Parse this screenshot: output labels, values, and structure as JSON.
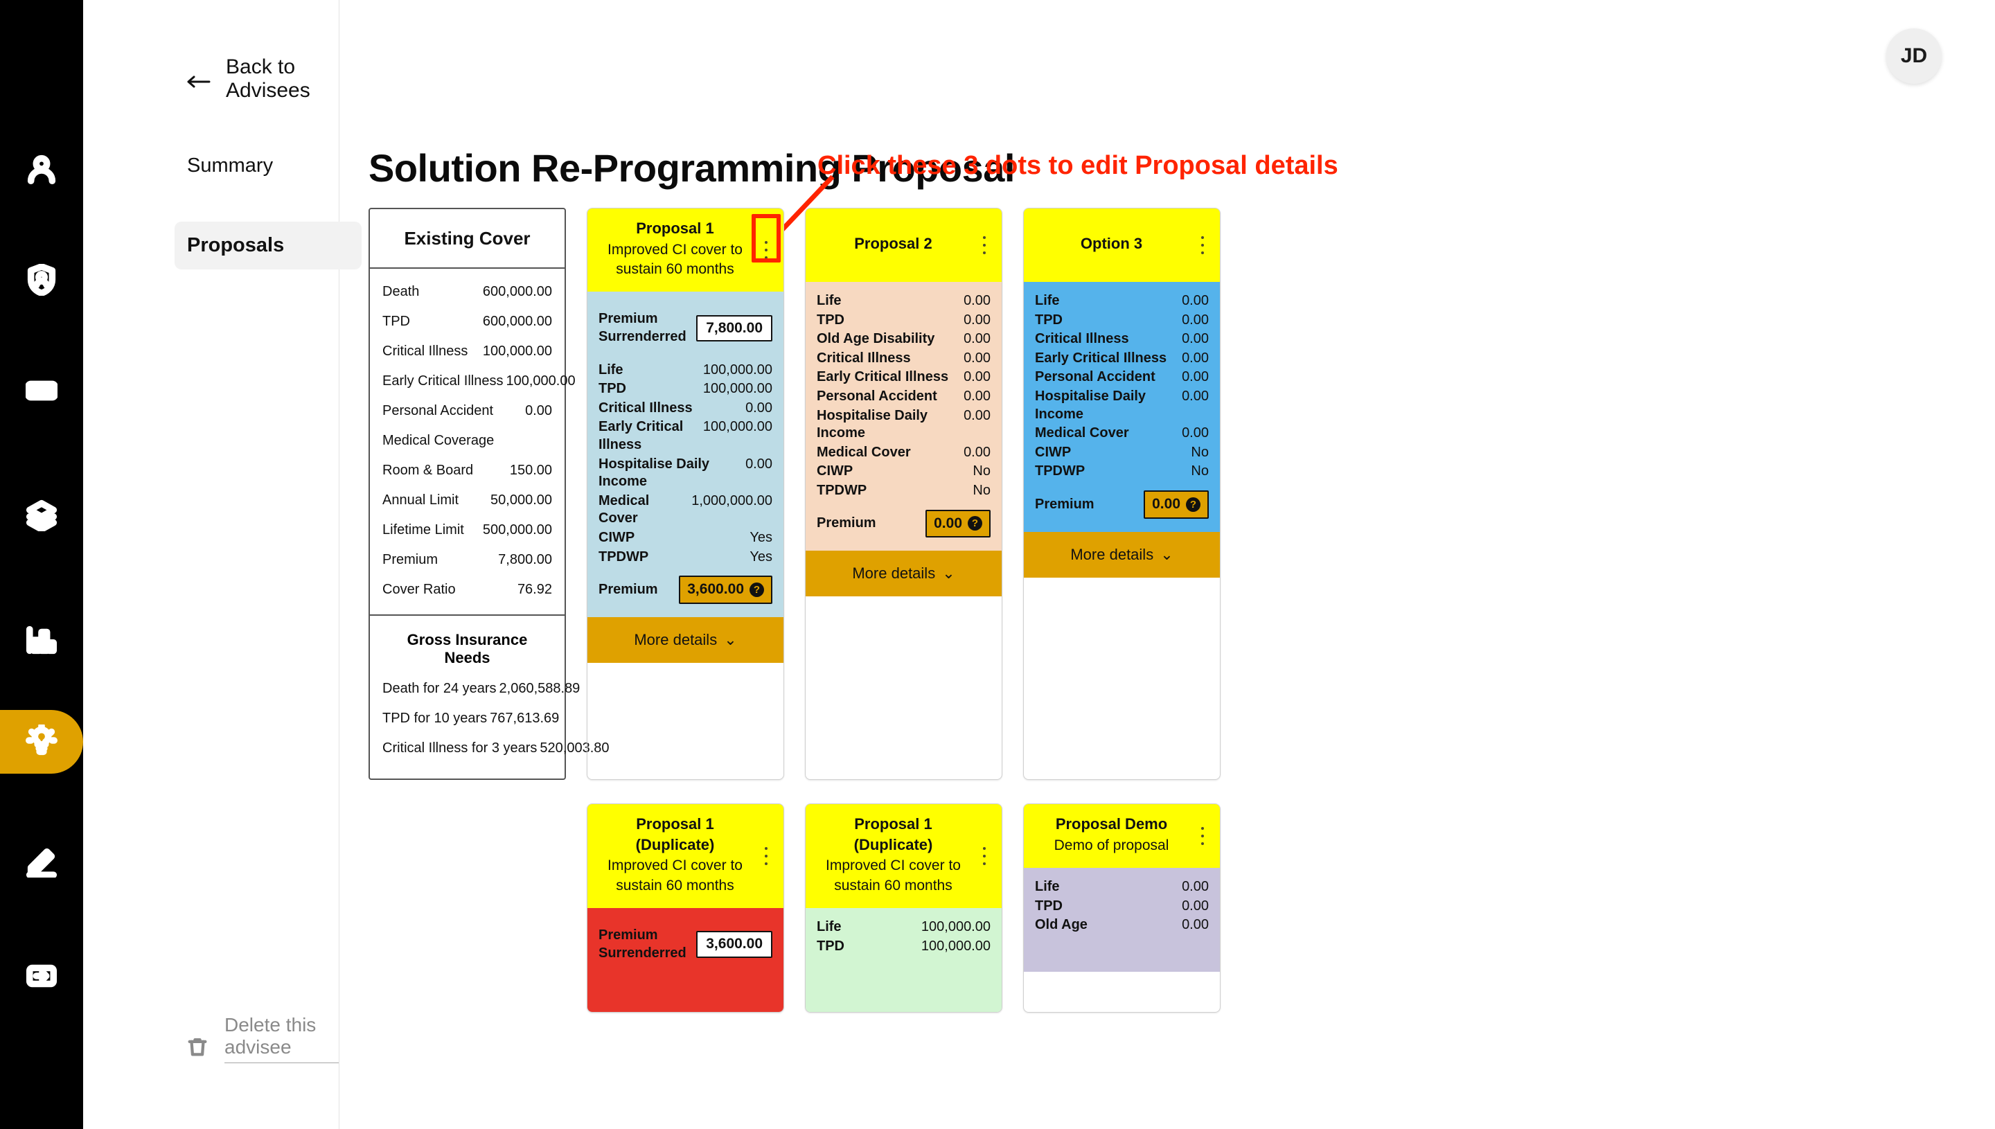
{
  "rail": {
    "items": [
      {
        "icon": "person-icon",
        "active": false
      },
      {
        "icon": "shield-person-icon",
        "active": false
      },
      {
        "icon": "banknote-icon",
        "active": false
      },
      {
        "icon": "layers-icon",
        "active": false
      },
      {
        "icon": "bar-chart-icon",
        "active": false
      },
      {
        "icon": "lightbulb-icon",
        "active": true
      },
      {
        "icon": "pencil-icon",
        "active": false
      },
      {
        "icon": "export-icon",
        "active": false
      }
    ]
  },
  "subnav": {
    "back_label": "Back to Advisees",
    "items": [
      {
        "label": "Summary",
        "selected": false
      },
      {
        "label": "Proposals",
        "selected": true
      }
    ],
    "delete_label": "Delete this advisee"
  },
  "header": {
    "avatar_initials": "JD"
  },
  "main": {
    "page_title": "Solution Re-Programming Proposal",
    "annotation": "Click these 3 dots to edit Proposal details"
  },
  "existing_cover": {
    "title": "Existing Cover",
    "rows": [
      {
        "label": "Death",
        "value": "600,000.00"
      },
      {
        "label": "TPD",
        "value": "600,000.00"
      },
      {
        "label": "Critical Illness",
        "value": "100,000.00"
      },
      {
        "label": "Early Critical Illness",
        "value": "100,000.00"
      },
      {
        "label": "Personal Accident",
        "value": "0.00"
      },
      {
        "label": "Medical Coverage",
        "value": ""
      },
      {
        "label": "Room & Board",
        "value": "150.00"
      },
      {
        "label": "Annual Limit",
        "value": "50,000.00"
      },
      {
        "label": "Lifetime Limit",
        "value": "500,000.00"
      },
      {
        "label": "Premium",
        "value": "7,800.00"
      },
      {
        "label": "Cover Ratio",
        "value": "76.92"
      }
    ],
    "gross_needs": {
      "title": "Gross Insurance Needs",
      "rows": [
        {
          "label": "Death for 24 years",
          "value": "2,060,588.89"
        },
        {
          "label": "TPD for 10 years",
          "value": "767,613.69"
        },
        {
          "label": "Critical Illness for 3 years",
          "value": "520,003.80"
        }
      ]
    }
  },
  "proposals": [
    {
      "title": "Proposal 1",
      "subtitle": "Improved CI cover to sustain 60 months",
      "body_color": "bg-blue",
      "top_premium": {
        "label": "Premium Surrenderred",
        "value": "7,800.00"
      },
      "rows": [
        {
          "label": "Life",
          "value": "100,000.00"
        },
        {
          "label": "TPD",
          "value": "100,000.00"
        },
        {
          "label": "Critical Illness",
          "value": "0.00"
        },
        {
          "label": "Early Critical Illness",
          "value": "100,000.00"
        },
        {
          "label": "Hospitalise Daily Income",
          "value": "0.00"
        },
        {
          "label": "Medical Cover",
          "value": "1,000,000.00"
        },
        {
          "label": "CIWP",
          "value": "Yes"
        },
        {
          "label": "TPDWP",
          "value": "Yes"
        }
      ],
      "premium": {
        "label": "Premium",
        "value": "3,600.00"
      },
      "more_details": "More details",
      "highlighted_kebab": true
    },
    {
      "title": "Proposal 2",
      "subtitle": "",
      "body_color": "bg-peach",
      "top_premium": null,
      "rows": [
        {
          "label": "Life",
          "value": "0.00"
        },
        {
          "label": "TPD",
          "value": "0.00"
        },
        {
          "label": "Old Age Disability",
          "value": "0.00"
        },
        {
          "label": "Critical Illness",
          "value": "0.00"
        },
        {
          "label": "Early Critical Illness",
          "value": "0.00"
        },
        {
          "label": "Personal Accident",
          "value": "0.00"
        },
        {
          "label": "Hospitalise Daily Income",
          "value": "0.00"
        },
        {
          "label": "Medical Cover",
          "value": "0.00"
        },
        {
          "label": "CIWP",
          "value": "No"
        },
        {
          "label": "TPDWP",
          "value": "No"
        }
      ],
      "premium": {
        "label": "Premium",
        "value": "0.00"
      },
      "more_details": "More details",
      "highlighted_kebab": false
    },
    {
      "title": "Option 3",
      "subtitle": "",
      "body_color": "bg-cyan",
      "top_premium": null,
      "rows": [
        {
          "label": "Life",
          "value": "0.00"
        },
        {
          "label": "TPD",
          "value": "0.00"
        },
        {
          "label": "Critical Illness",
          "value": "0.00"
        },
        {
          "label": "Early Critical Illness",
          "value": "0.00"
        },
        {
          "label": "Personal Accident",
          "value": "0.00"
        },
        {
          "label": "Hospitalise Daily Income",
          "value": "0.00"
        },
        {
          "label": "Medical Cover",
          "value": "0.00"
        },
        {
          "label": "CIWP",
          "value": "No"
        },
        {
          "label": "TPDWP",
          "value": "No"
        }
      ],
      "premium": {
        "label": "Premium",
        "value": "0.00"
      },
      "more_details": "More details",
      "highlighted_kebab": false
    },
    {
      "title": "Proposal 1 (Duplicate)",
      "subtitle": "Improved CI cover to sustain 60 months",
      "body_color": "bg-red",
      "top_premium": {
        "label": "Premium Surrenderred",
        "value": "3,600.00"
      },
      "rows": [],
      "premium": null,
      "more_details": "",
      "highlighted_kebab": false
    },
    {
      "title": "Proposal 1 (Duplicate)",
      "subtitle": "Improved CI cover to sustain 60 months",
      "body_color": "bg-green",
      "top_premium": null,
      "rows": [
        {
          "label": "Life",
          "value": "100,000.00"
        },
        {
          "label": "TPD",
          "value": "100,000.00"
        }
      ],
      "premium": null,
      "more_details": "",
      "highlighted_kebab": false
    },
    {
      "title": "Proposal Demo",
      "subtitle": "Demo of proposal",
      "body_color": "bg-purple",
      "top_premium": null,
      "rows": [
        {
          "label": "Life",
          "value": "0.00"
        },
        {
          "label": "TPD",
          "value": "0.00"
        },
        {
          "label": "Old Age",
          "value": "0.00"
        }
      ],
      "premium": null,
      "more_details": "",
      "highlighted_kebab": false
    }
  ],
  "colors": {
    "accent_gold": "#DFA100",
    "annotation_red": "#FF2400",
    "header_yellow": "#FFFF00"
  }
}
